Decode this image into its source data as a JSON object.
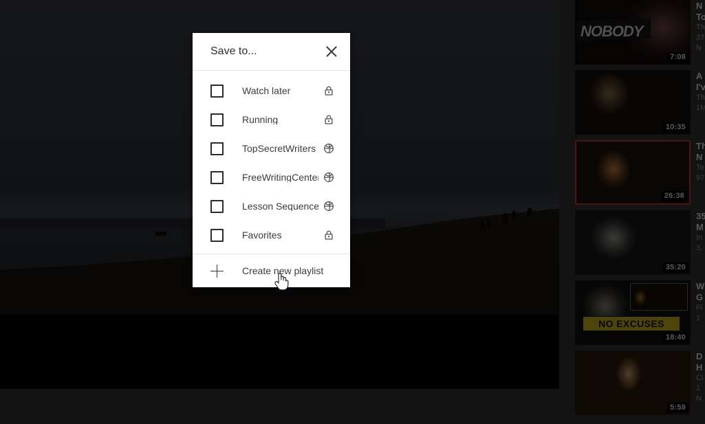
{
  "modal": {
    "title": "Save to...",
    "close_icon": "close-icon",
    "playlists": [
      {
        "name": "Watch later",
        "checked": false,
        "privacy": "private",
        "privacy_icon": "lock-icon"
      },
      {
        "name": "Running",
        "checked": false,
        "privacy": "private",
        "privacy_icon": "lock-icon"
      },
      {
        "name": "TopSecretWriters",
        "checked": false,
        "privacy": "public",
        "privacy_icon": "globe-icon"
      },
      {
        "name": "FreeWritingCenter",
        "checked": false,
        "privacy": "public",
        "privacy_icon": "globe-icon"
      },
      {
        "name": "Lesson Sequence",
        "checked": false,
        "privacy": "public",
        "privacy_icon": "globe-icon"
      },
      {
        "name": "Favorites",
        "checked": false,
        "privacy": "private",
        "privacy_icon": "lock-icon"
      }
    ],
    "create_label": "Create new playlist",
    "create_icon": "plus-icon"
  },
  "player": {
    "state": "playing",
    "scene": "dusk landscape with hill silhouette"
  },
  "sidebar": {
    "related": [
      {
        "duration": "7:08",
        "title_clip": "N",
        "line2_clip": "To",
        "line3_clip": "Th",
        "line4_clip": "37",
        "line5_clip": "N",
        "art": "art-nobody",
        "highlighted": false
      },
      {
        "duration": "10:35",
        "title_clip": "A",
        "line2_clip": "I'v",
        "line3_clip": "Th",
        "line4_clip": "1M",
        "line5_clip": "",
        "art": "art-westworld",
        "highlighted": false
      },
      {
        "duration": "26:38",
        "title_clip": "Th",
        "line2_clip": "N",
        "line3_clip": "Te",
        "line4_clip": "97",
        "line5_clip": "",
        "art": "art-conan",
        "highlighted": true
      },
      {
        "duration": "35:20",
        "title_clip": "35",
        "line2_clip": "M",
        "line3_clip": "In",
        "line4_clip": "3.",
        "line5_clip": "",
        "art": "art-interview",
        "highlighted": false
      },
      {
        "duration": "18:40",
        "title_clip": "W",
        "line2_clip": "G",
        "line3_clip": "Fl",
        "line4_clip": "1",
        "line5_clip": "",
        "art": "art-excuses",
        "highlighted": false
      },
      {
        "duration": "5:59",
        "title_clip": "D",
        "line2_clip": "H",
        "line3_clip": "Cl",
        "line4_clip": "1",
        "line5_clip": "N",
        "art": "art-desperado",
        "highlighted": false
      }
    ]
  },
  "colors": {
    "page_background": "#333333",
    "modal_background": "#ffffff",
    "modal_text": "#3c3c3c",
    "overlay": "rgba(0,0,0,0.62)",
    "highlight_border": "#c0392b"
  },
  "cursor": {
    "type": "pointer-hand",
    "over": "Create new playlist"
  }
}
